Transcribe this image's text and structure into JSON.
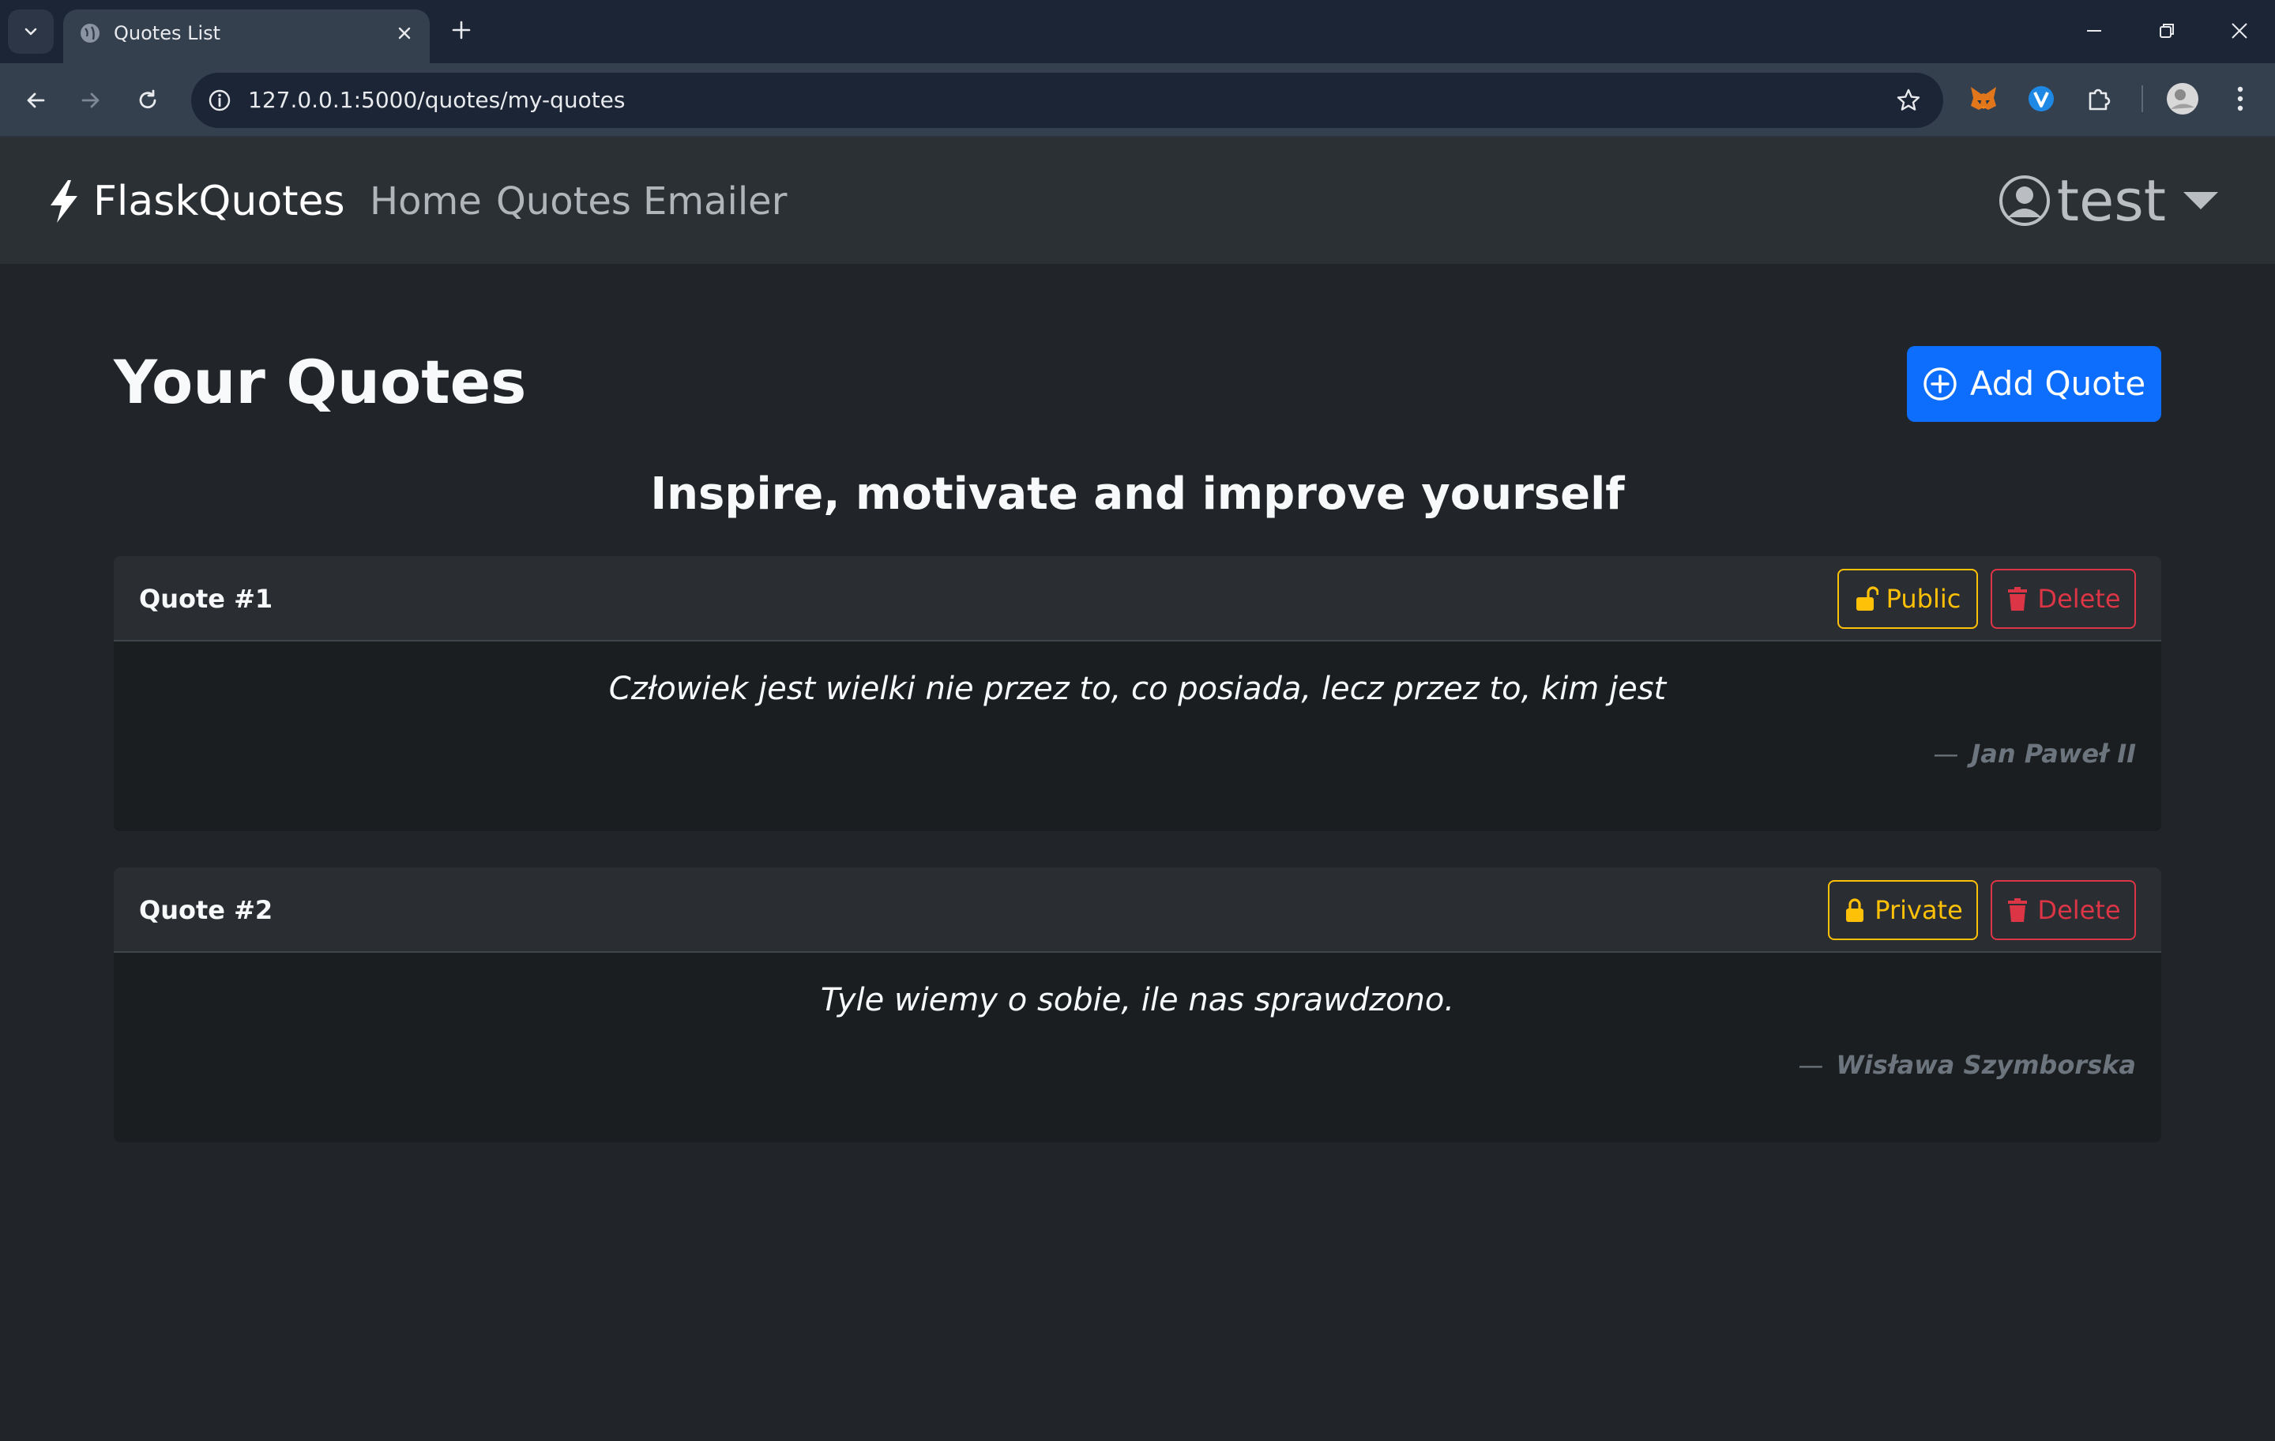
{
  "browser": {
    "tab_title": "Quotes List",
    "url": "127.0.0.1:5000/quotes/my-quotes"
  },
  "navbar": {
    "brand": "FlaskQuotes",
    "links": [
      "Home",
      "Quotes",
      "Emailer"
    ],
    "user": "test"
  },
  "page": {
    "title": "Your Quotes",
    "add_button": "Add Quote",
    "subtitle": "Inspire, motivate and improve yourself"
  },
  "quotes": [
    {
      "title": "Quote #1",
      "visibility": "Public",
      "delete": "Delete",
      "text": "Człowiek jest wielki nie przez to, co posiada, lecz przez to, kim jest",
      "author": "Jan Paweł II"
    },
    {
      "title": "Quote #2",
      "visibility": "Private",
      "delete": "Delete",
      "text": "Tyle wiemy o sobie, ile nas sprawdzono.",
      "author": "Wisława Szymborska"
    }
  ],
  "colors": {
    "primary": "#0d6efd",
    "warning": "#ffc107",
    "danger": "#dc3545",
    "background": "#212529",
    "navbar": "#2b3035"
  }
}
